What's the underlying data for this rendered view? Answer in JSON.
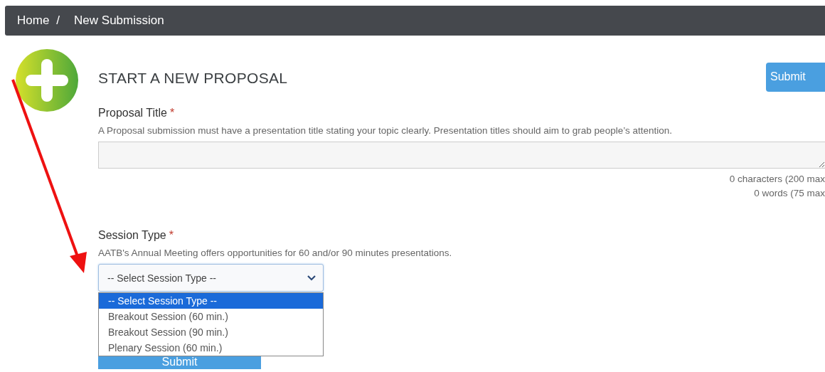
{
  "breadcrumb": [
    "Home",
    "New Submission"
  ],
  "breadcrumb_separator": "/",
  "page_title": "START A NEW PROPOSAL",
  "top_button": "Submit",
  "fields": [
    {
      "kind": "textarea",
      "label": "Proposal Title",
      "required_mark": "*",
      "help": "A Proposal submission must have a presentation title stating your topic clearly. Presentation titles should aim to grab people’s attention.",
      "counters": [
        "0 characters (200 max",
        "0 words (75 max"
      ]
    },
    {
      "kind": "select",
      "label": "Session Type",
      "required_mark": "*",
      "help": "AATB's Annual Meeting offers opportunities for 60 and/or 90 minutes presentations.",
      "value": "-- Select Session Type --",
      "expanded": true,
      "options": [
        {
          "label": "-- Select Session Type --",
          "selected": true
        },
        {
          "label": "Breakout Session (60 min.)",
          "selected": false
        },
        {
          "label": "Breakout Session (90 min.)",
          "selected": false
        },
        {
          "label": "Plenary Session (60 min.)",
          "selected": false
        }
      ]
    }
  ],
  "bottom_button": "Submit"
}
